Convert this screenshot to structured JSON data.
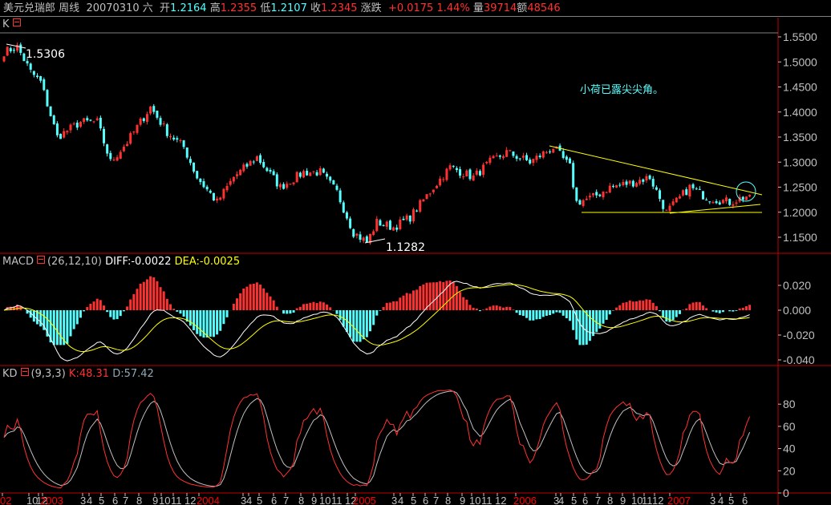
{
  "header": {
    "instrument": "美元兑瑞郎",
    "period": "周线",
    "date": "20070310",
    "weekday": "六",
    "open_label": "开",
    "open": "1.2164",
    "high_label": "高",
    "high": "1.2355",
    "low_label": "低",
    "low": "1.2107",
    "close_label": "收",
    "close": "1.2345",
    "change_label": "涨跌",
    "change": "+0.0175",
    "change_pct": "1.44%",
    "volume_label": "量",
    "volume": "39714",
    "amount_label": "额",
    "amount": "48546"
  },
  "panels": {
    "k": {
      "name": "K"
    },
    "macd": {
      "name": "MACD",
      "params": "(26,12,10)",
      "diff": "DIFF:-0.0022",
      "dea": "DEA:-0.0025"
    },
    "kd": {
      "name": "KD",
      "params": "(9,3,3)",
      "k": "K:48.31",
      "d": "D:57.42"
    }
  },
  "annotations": {
    "high_mark": "1.5306",
    "low_mark": "1.1282",
    "note": "小荷已露尖尖角。"
  },
  "colors": {
    "up": "#ff3232",
    "down": "#54ffff",
    "diff": "#ffffff",
    "dea": "#ffff00",
    "trend": "#ffff00",
    "grid": "#c00000"
  },
  "chart_data": [
    {
      "type": "candlestick",
      "title": "美元兑瑞郎 周线",
      "weeks": 225,
      "ylim": [
        1.11,
        1.57
      ],
      "yticks": [
        "1.5500",
        "1.5000",
        "1.4500",
        "1.4000",
        "1.3500",
        "1.3000",
        "1.2500",
        "1.2000",
        "1.1500"
      ],
      "close_keypoints": [
        [
          0,
          1.52
        ],
        [
          4,
          1.53
        ],
        [
          8,
          1.48
        ],
        [
          11,
          1.46
        ],
        [
          16,
          1.35
        ],
        [
          23,
          1.38
        ],
        [
          28,
          1.38
        ],
        [
          32,
          1.3
        ],
        [
          37,
          1.34
        ],
        [
          44,
          1.41
        ],
        [
          49,
          1.36
        ],
        [
          54,
          1.33
        ],
        [
          58,
          1.27
        ],
        [
          64,
          1.22
        ],
        [
          69,
          1.27
        ],
        [
          76,
          1.31
        ],
        [
          83,
          1.25
        ],
        [
          90,
          1.28
        ],
        [
          95,
          1.28
        ],
        [
          100,
          1.24
        ],
        [
          105,
          1.16
        ],
        [
          109,
          1.14
        ],
        [
          112,
          1.18
        ],
        [
          117,
          1.17
        ],
        [
          122,
          1.19
        ],
        [
          129,
          1.25
        ],
        [
          134,
          1.29
        ],
        [
          141,
          1.27
        ],
        [
          146,
          1.3
        ],
        [
          151,
          1.32
        ],
        [
          158,
          1.3
        ],
        [
          165,
          1.33
        ],
        [
          170,
          1.29
        ],
        [
          172,
          1.22
        ],
        [
          177,
          1.23
        ],
        [
          182,
          1.25
        ],
        [
          189,
          1.26
        ],
        [
          194,
          1.27
        ],
        [
          199,
          1.2
        ],
        [
          206,
          1.25
        ],
        [
          211,
          1.23
        ],
        [
          218,
          1.22
        ],
        [
          224,
          1.2345
        ]
      ]
    },
    {
      "type": "bar+line",
      "title": "MACD",
      "yticks": [
        "0.020",
        "0.000",
        "-0.020",
        "-0.040"
      ],
      "ylim": [
        -0.042,
        0.03
      ],
      "series": [
        "DIFF",
        "DEA",
        "MACD"
      ]
    },
    {
      "type": "line",
      "title": "KD",
      "yticks": [
        "80",
        "60",
        "40",
        "20",
        "0"
      ],
      "ylim": [
        0,
        100
      ],
      "series": [
        "K",
        "D"
      ]
    }
  ],
  "xaxis": {
    "labels": [
      "02",
      "10",
      "12",
      "2003",
      "3",
      "4",
      "5",
      "6",
      "7",
      "8",
      "9",
      "10",
      "11",
      "12",
      "2004",
      "3",
      "4",
      "5",
      "6",
      "7",
      "8",
      "9",
      "10",
      "11",
      "12",
      "2005",
      "3",
      "4",
      "5",
      "6",
      "7",
      "8",
      "9",
      "10",
      "11",
      "12",
      "2006",
      "3",
      "4",
      "5",
      "6",
      "7",
      "8",
      "9",
      "10",
      "11",
      "12",
      "2007",
      "3",
      "4",
      "5",
      "6"
    ]
  }
}
